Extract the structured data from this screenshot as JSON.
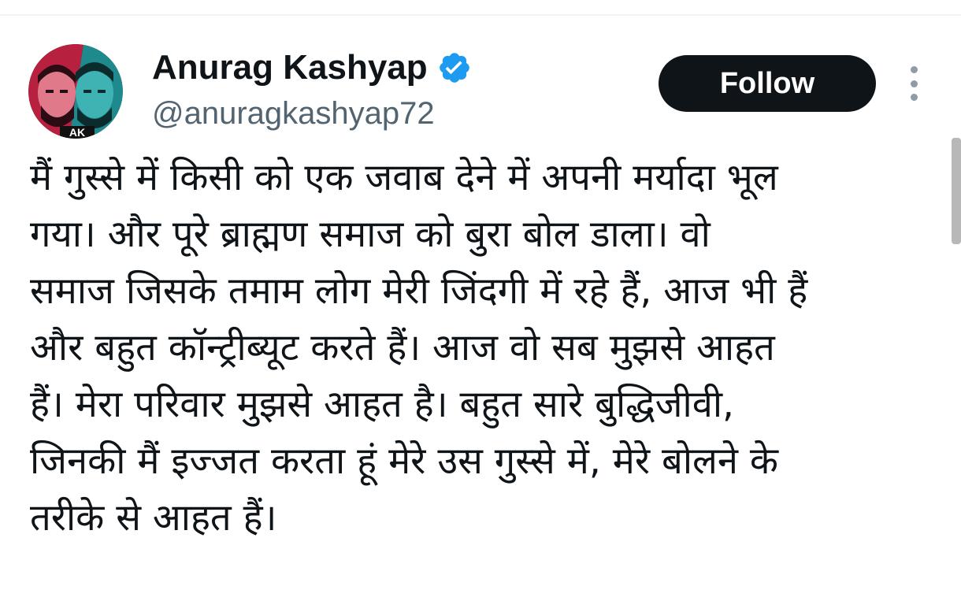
{
  "author": {
    "display_name": "Anurag Kashyap",
    "handle": "@anuragkashyap72",
    "verified_icon": "verified-badge-icon",
    "avatar_text": "AK"
  },
  "actions": {
    "follow_label": "Follow",
    "more_icon": "more-vertical-icon"
  },
  "tweet": {
    "lines": [
      "मैं गुस्से में किसी को एक जवाब देने में अपनी मर्यादा भूल",
      "गया। और पूरे ब्राह्मण समाज को बुरा बोल डाला। वो",
      "समाज जिसके तमाम लोग मेरी जिंदगी में रहे हैं, आज भी हैं",
      "और बहुत कॉन्ट्रीब्यूट करते हैं। आज वो सब मुझसे आहत",
      "हैं। मेरा परिवार मुझसे आहत है। बहुत सारे बुद्धिजीवी,",
      "जिनकी मैं इज्जत करता हूं मेरे उस गुस्से में, मेरे बोलने के",
      "तरीके से आहत हैं।"
    ]
  },
  "colors": {
    "text_primary": "#0f1419",
    "text_secondary": "#536471",
    "verified_blue": "#1d9bf0",
    "button_bg": "#0f1419",
    "button_text": "#ffffff"
  }
}
